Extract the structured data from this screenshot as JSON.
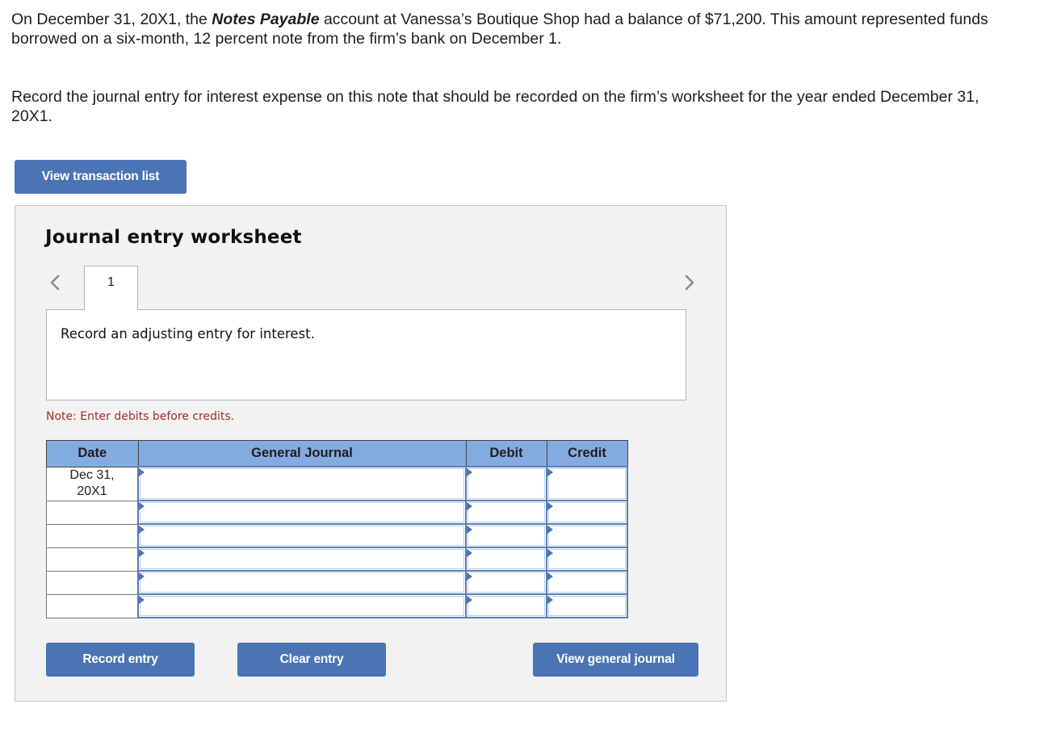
{
  "problem": {
    "paragraph1_before": "On December 31, 20X1, the ",
    "paragraph1_bold": "Notes Payable",
    "paragraph1_after": " account at Vanessa’s Boutique Shop had a balance of $71,200. This amount represented funds borrowed on a six-month, 12 percent note from the firm’s bank on December 1.",
    "paragraph2": "Record the journal entry for interest expense on this note that should be recorded on the firm’s worksheet for the year ended December 31, 20X1."
  },
  "buttons": {
    "view_transaction_list": "View transaction list",
    "record_entry": "Record entry",
    "clear_entry": "Clear entry",
    "view_general_journal": "View general journal"
  },
  "worksheet": {
    "title": "Journal entry worksheet",
    "tabs": [
      {
        "label": "1"
      }
    ],
    "prev_icon": "chevron-left-icon",
    "next_icon": "chevron-right-icon",
    "instruction": "Record an adjusting entry for interest.",
    "note": "Note: Enter debits before credits."
  },
  "journal": {
    "headers": {
      "date": "Date",
      "account": "General Journal",
      "debit": "Debit",
      "credit": "Credit"
    },
    "rows": [
      {
        "date": "Dec 31, 20X1",
        "account": "",
        "debit": "",
        "credit": ""
      },
      {
        "date": "",
        "account": "",
        "debit": "",
        "credit": ""
      },
      {
        "date": "",
        "account": "",
        "debit": "",
        "credit": ""
      },
      {
        "date": "",
        "account": "",
        "debit": "",
        "credit": ""
      },
      {
        "date": "",
        "account": "",
        "debit": "",
        "credit": ""
      },
      {
        "date": "",
        "account": "",
        "debit": "",
        "credit": ""
      }
    ]
  },
  "colors": {
    "button_blue": "#4a74b3",
    "header_blue": "#84abe0",
    "note_red": "#a82a2a",
    "panel_bg": "#f2f2f2"
  }
}
